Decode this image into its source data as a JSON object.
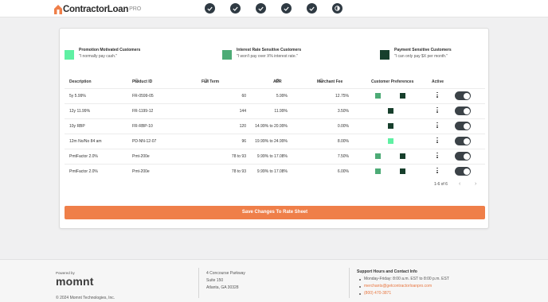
{
  "header": {
    "logo_text": "ContractorLoan",
    "logo_sup": "PRO",
    "steps": [
      {
        "state": "complete",
        "icon": "check-icon"
      },
      {
        "state": "complete",
        "icon": "check-icon"
      },
      {
        "state": "complete",
        "icon": "check-icon"
      },
      {
        "state": "complete",
        "icon": "check-icon"
      },
      {
        "state": "complete",
        "icon": "check-icon"
      },
      {
        "state": "current",
        "icon": "half-circle-icon"
      }
    ]
  },
  "colors": {
    "promotion": "#5ff0a3",
    "interest": "#4dab76",
    "payment": "#173f2c",
    "accent": "#ef7f49",
    "toggle": "#3b4247"
  },
  "preferences": {
    "promotion": {
      "title": "Promotion Motivated Customers",
      "subtitle": "\"I normally pay cash.\""
    },
    "interest": {
      "title": "Interest Rate Sensitive Customers",
      "subtitle": "\"I won't pay over X% interest rate.\""
    },
    "payment": {
      "title": "Payment Sensitive Customers",
      "subtitle": "\"I can only pay $X per month.\""
    }
  },
  "table": {
    "headers": {
      "description": "Description",
      "product_id": "Product ID",
      "full_term": "Full Term",
      "apr": "APR",
      "merchant_fee": "Merchant Fee",
      "customer_preferences": "Customer Preferences",
      "active": "Active"
    },
    "rows": [
      {
        "description": "5y 5.99%",
        "product_id": "FR-0599-05",
        "full_term": "60",
        "apr": "5.99%",
        "merchant_fee": "12.75%",
        "prefs": [
          "interest",
          "payment"
        ],
        "active": true
      },
      {
        "description": "12y 11.99%",
        "product_id": "FR-1199-12",
        "full_term": "144",
        "apr": "11.99%",
        "merchant_fee": "3.50%",
        "prefs": [
          "payment"
        ],
        "active": true
      },
      {
        "description": "10y RBP",
        "product_id": "FR-RBP-10",
        "full_term": "120",
        "apr": "14.99% to 20.99%",
        "merchant_fee": "0.00%",
        "prefs": [
          "payment"
        ],
        "active": true
      },
      {
        "description": "12m No/No 84 am",
        "product_id": "PD-NN-12-07",
        "full_term": "96",
        "apr": "19.99% to 24.99%",
        "merchant_fee": "8.00%",
        "prefs": [
          "promotion"
        ],
        "active": true
      },
      {
        "description": "PmtFactor 2.0%",
        "product_id": "Pmt-200e",
        "full_term": "78 to 93",
        "apr": "9.99% to 17.08%",
        "merchant_fee": "7.50%",
        "prefs": [
          "interest",
          "payment"
        ],
        "active": true
      },
      {
        "description": "PmtFactor 2.0%",
        "product_id": "Pmt-200e",
        "full_term": "78 to 93",
        "apr": "9.99% to 17.08%",
        "merchant_fee": "6.00%",
        "prefs": [
          "interest",
          "payment"
        ],
        "active": true
      }
    ]
  },
  "pagination": {
    "label": "1-6 of 6",
    "prev_icon": "chevron-left-icon",
    "next_icon": "chevron-right-icon"
  },
  "save_button": "Save Changes To Rate Sheet",
  "footer": {
    "powered_by": "Powered by",
    "brand": "momnt",
    "copyright": "© 2024 Momnt Technologies, Inc.",
    "address": [
      "4 Concourse Parkway",
      "Suite 150",
      "Atlanta, GA 30328"
    ],
    "support_title": "Support Hours and Contact Info",
    "support_hours": "Monday-Friday: 8:00 a.m. EST to 8:00 p.m. EST",
    "support_email": "merchants@getcontractorloanpro.com",
    "support_phone": "(800) 470-3871"
  }
}
